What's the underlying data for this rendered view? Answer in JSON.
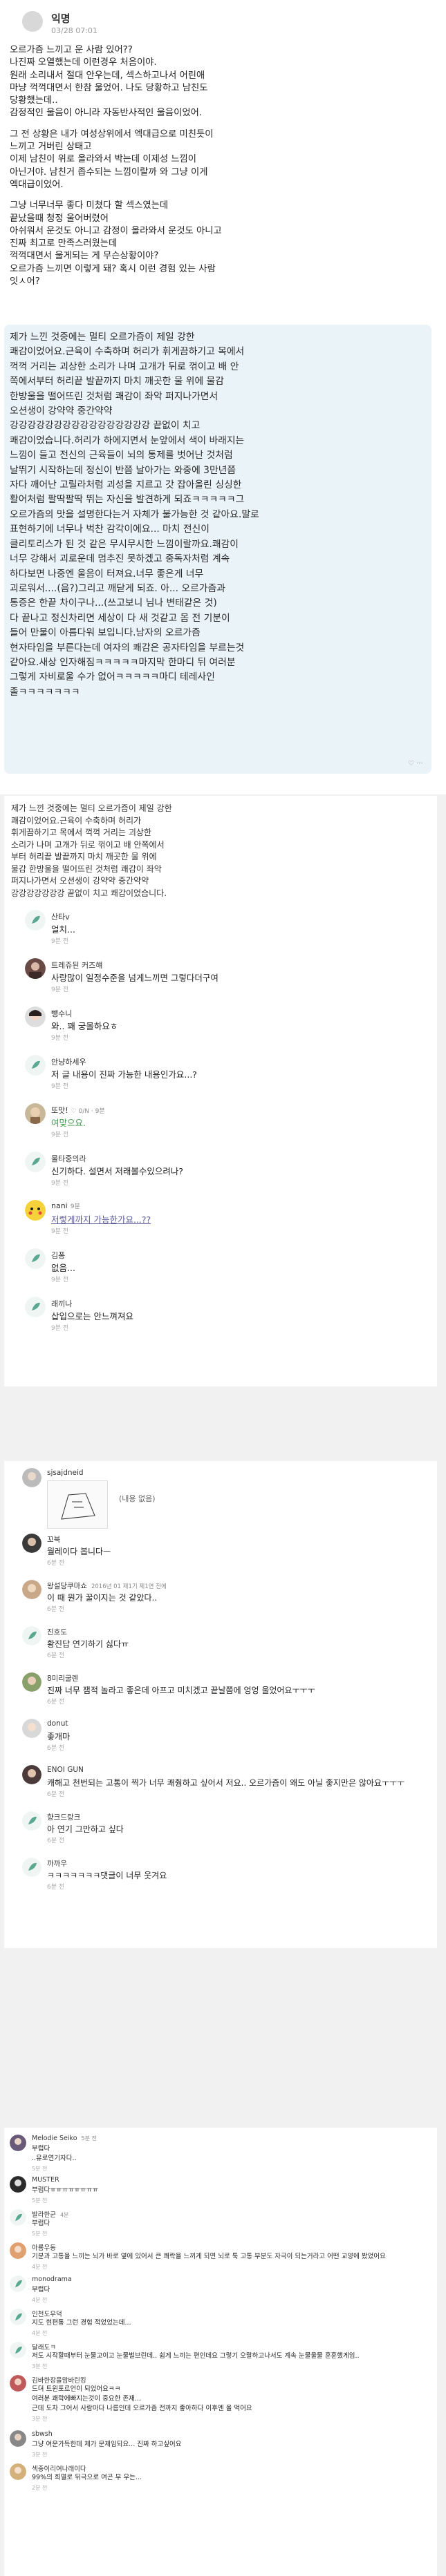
{
  "post": {
    "author": "익명",
    "date": "03/28 07:01",
    "body": [
      "오르가즘 느끼고 운 사람 있어??",
      "나진짜 오열했는데 이런경우 처음이야.",
      "원래 소리내서 절대 안우는데, 섹스하고나서 어린애",
      "마냥 꺽꺽대면서 한참 울었어. 나도 당황하고 남친도",
      "당황했는데..",
      "감정적인 울음이 아니라 자동반사적인 울음이었어.",
      "",
      "그 전 상황은 내가 여성상위에서 엑대급으로 미친듯이",
      "느끼고 거버린 상태고",
      "이제 남친이 위로 올라와서 박는데 이제성 느낌이",
      "아닌거야. 남친거 좁수되는 느낌이랄까 와 그냥 이게",
      "엑대급이었어.",
      "",
      "그냥 너무너무 좋다 미쳤다 할 섹스였는데",
      "끝났을때 청정 울어버렸어",
      "아쉬워서 운것도 아니고 감정이 올라와서 운것도 아니고",
      "진짜 최고로 만족스러웠는데",
      "꺽꺽대면서 울게되는 게 무슨상황이야?",
      "오르가즘 느끼면 이렇게 돼? 혹시 이런 경험 있는 사람",
      "잇ㅅ어?"
    ],
    "reply_bubble": [
      "제가 느낀 것중에는 멀티 오르가즘이 제일 강한",
      "쾌감이었어요.근육이 수축하며 허리가 휘게끔하기고 목에서",
      "꺽꺽 거리는 괴상한 소리가 나며 고개가 뒤로 꺾이고 배 안",
      "쪽에서부터 허리끝 발끝까지 마치 깨곳한 물 위에 물감",
      "한방울을 떨어뜨린 것처럼 쾌감이 좌악 퍼지나가면서",
      "오션생이 강약약 중간약약",
      "강강강강강강강강강강강강강강강강 끝없이 치고",
      "쾌감이었습니다.허리가 하에지면서 눈앞에서 색이 바래지는",
      "느낌이 들고 전신의 근육들이 뇌의 통제를 벗어난 것처럼",
      "날뛰기 시작하는데 정신이 반쯤 날아가는 와중에 3만년쯤",
      "자다 깨어난 고릴라처럼 괴성을 지르고 갓 잡아올린 싱싱한",
      "활어처럼 팔딱팔딱 뛰는 자신을 발견하게 되죠ㅋㅋㅋㅋㅋ그",
      "오르가즘의 맛을 설명한다는거 자체가 불가능한 것 같아요.말로",
      "표현하기에 너무나 벅찬 감각이에요... 마치 전신이",
      "클리토리스가 된 것 같은 무시무시한 느낌이랄까요.쾌감이",
      "너무 강해서 괴로운데 멈추진 못하겠고 중독자처럼 계속",
      "하다보면 나중엔 울음이 터져요.너무 좋은게 너무",
      "괴로워서....(음?)그리고 깨닫게 되죠. 아... 오르가즘과",
      "통증은 한끝 차이구나...(쓰고보니 님나 변태같은 것)",
      "다 끝나고 정신차리면 세상이 다 새 것같고 몸 전 기분이",
      "들어 만물이 아름다워 보입니다.남자의 오르가즘",
      "현자타임을 부른다는데 여자의 쾌감은 공자타임을 부르는것",
      "같아요.새상 인자해짐ㅋㅋㅋㅋㅋ마지막 한마디 뒤 여러분",
      "그렇게 자비로울 수가 없어ㅋㅋㅋㅋㅋ마디 테레사인",
      "졸ㅋㅋㅋㅋㅋㅋㅋ"
    ],
    "reply_meta": "♡ ···"
  },
  "section2": {
    "quote": [
      "제가 느낀 것중에는 멀티 오르가즘이 제일 강한",
      "쾌감이었어요.근육이 수축하며 허리가",
      "휘게끔하기고 목에서 꺽꺽 거리는 괴상한",
      "소리가 나며 고개가 뒤로 꺾이고 배 안쪽에서",
      "부터 허리끝 발끝까지 마치 깨곳한 물 위에",
      "물감 한방울을 떨어뜨린 것처럼 쾌감이 좌악",
      "퍼지나가면서 오션생이 강약약 중간약약",
      "강강강강강강강 끝없이 치고 쾌감이었습니다."
    ],
    "comments": [
      {
        "name": "산타v",
        "text": "얼치...",
        "time": "9분 전"
      },
      {
        "name": "트레쥬된 커즈햬",
        "text": "사랑많이 일정수준을 넘게느끼면 그렇다더구여",
        "time": "9분 전"
      },
      {
        "name": "뺑수니",
        "text": "와.. 꽤 궁몰하요ㅎ",
        "time": "9분 전"
      },
      {
        "name": "안냥하세우",
        "text": "저 글 내용이 진짜 가능한 내용인가요...?",
        "time": "9분 전"
      },
      {
        "name": "또맛!",
        "tag": "♡ 0/N · 9분",
        "text": "여맞으요.",
        "time": "9분 전"
      },
      {
        "name": "물타중의라",
        "text": "신기하다. 설면서 저래볼수있으려나?",
        "time": "9분 전"
      },
      {
        "name": "nani",
        "tag": "9분",
        "text": "저렇게까지 가능한가요...??",
        "time": "9분 전"
      },
      {
        "name": "김퐁",
        "text": "없음...",
        "time": "9분 전"
      },
      {
        "name": "래끼나",
        "text": "삽입으로는 안느껴져요",
        "time": "9분 전"
      }
    ]
  },
  "section3": {
    "first": {
      "name": "sjsajdneid",
      "caption": "(내용 없음)"
    },
    "comments": [
      {
        "name": "꼬북",
        "text": "월레이다 봅니다ㅡ",
        "time": "6분 전"
      },
      {
        "name": "왕설당쿠마쇼",
        "sub": "2016년 01 제1기 제1연 전에",
        "text": "이 때 뭔가 꿀이지는 것 같았다..",
        "time": "6분 전"
      },
      {
        "name": "진호도",
        "text": "황진답 연기하기 싫다ㅠ",
        "time": "6분 전"
      },
      {
        "name": "8미리굴렌",
        "text": "진짜 너무 잼적 놀라고 좋은데 아프고 미치겠고 끝날쯤에 엉엉 울었어요ㅜㅜㅜ",
        "time": "6분 전"
      },
      {
        "name": "donut",
        "text": "좋개마",
        "time": "6분 전"
      },
      {
        "name": "ENOI GUN",
        "text": "캐해고 천번되는 고통이 찍가 너무 쾌줭하고 싶어서 저요.. 오르가즘이 왜도 아닐 좋지만은 않아요ㅜㅜㅜ",
        "time": "6분 전"
      },
      {
        "name": "향크드랑크",
        "text": "아 연기 그만하고 싶다",
        "time": "6분 전"
      },
      {
        "name": "까까우",
        "text": "ㅋㅋㅋㅋㅋㅋㅋ댓글이 너무 웃겨요",
        "time": "6분 전"
      }
    ]
  },
  "section4": {
    "comments": [
      {
        "name": "Melodie Seiko",
        "sub": "5분 전",
        "lines": [
          "부럽다",
          "..유로연기자다.."
        ],
        "time": "5분 전"
      },
      {
        "name": "MUSTER",
        "lines": [
          "부럽다ㅠㅠㅠㅠㅠㅠㅠㅠ"
        ],
        "time": "5분 전"
      },
      {
        "name": "발라한군",
        "sub": "4분",
        "lines": [
          "부럽다"
        ],
        "time": "5분 전"
      },
      {
        "name": "아룡우동",
        "lines": [
          "기분과 고통을 느끼는 뇌가 바로 옆에 있어서 큰 쾌락을 느끼게 되면 뇌로 툭 고통 부분도 자극이 되는거라고 어떤 교양에 봤었어요"
        ],
        "time": "4분 전"
      },
      {
        "name": "monodrama",
        "lines": [
          "부럽다"
        ],
        "time": "4분 전"
      },
      {
        "name": "인천도우덕",
        "lines": [
          "지도 현편통 그런 경험 적었었는데..."
        ],
        "time": "4분 전"
      },
      {
        "name": "달래도ㅋ",
        "lines": [
          "저도 시작할때부터 눈물고이고 눈물벌브린데.. 쉽게 느끼는 편인데요 그렇기 오랄하고나서도 계속 눈물울물 훈훈했게임.."
        ],
        "time": "3분 전"
      },
      {
        "name": "김바한장을맘바린킹",
        "lines": [
          "드뎌 트윈포르언이 되었어요ㅋㅋ",
          "여러분 쾌락에빠지는것이 중요한 존재...",
          "근데 도차 그어서 사람마다 나름인데 오르가즘 전까지 좋아하다 이후엔 울 먹어요"
        ],
        "time": "3분 전"
      },
      {
        "name": "sbwsh",
        "lines": [
          "그냥 여운가득한데 체가 문제임되요... 진짜 하고싶어요"
        ],
        "time": "3분 전"
      },
      {
        "name": "섹중이리여나래이다",
        "lines": [
          "99%의 희열로 뒤극으로 여곤 부 우는..."
        ],
        "time": "2분 전"
      }
    ]
  },
  "colors": {
    "bubble": "#eaf3f7",
    "background": "#f1f1f1",
    "green_text": "#3a9a4a"
  }
}
